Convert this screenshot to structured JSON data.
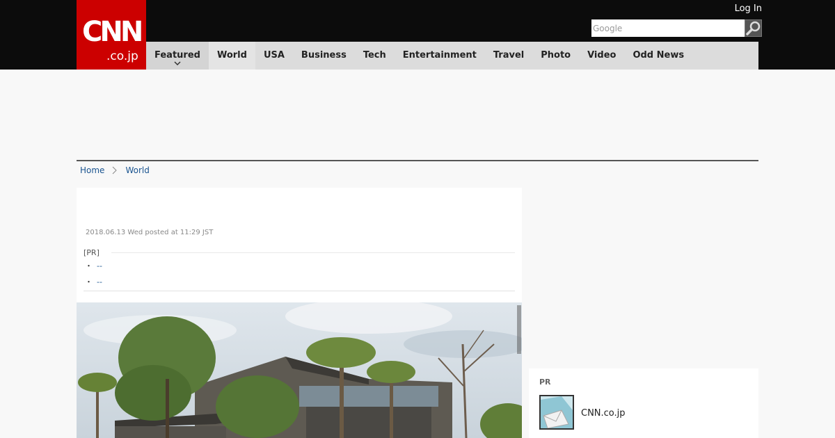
{
  "header": {
    "logo_main": "CNN",
    "logo_sub": ".co.jp",
    "login_label": "Log In",
    "search_placeholder": "Google"
  },
  "nav": {
    "items": [
      {
        "label": "Featured"
      },
      {
        "label": "World"
      },
      {
        "label": "USA"
      },
      {
        "label": "Business"
      },
      {
        "label": "Tech"
      },
      {
        "label": "Entertainment"
      },
      {
        "label": "Travel"
      },
      {
        "label": "Photo"
      },
      {
        "label": "Video"
      },
      {
        "label": "Odd News"
      }
    ]
  },
  "breadcrumb": {
    "home": "Home",
    "section": "World"
  },
  "article": {
    "date": "2018.06.13 Wed posted at 11:29 JST",
    "pr_label": "[PR]",
    "pr_items": [
      {
        "bullet": "・",
        "link": "--"
      },
      {
        "bullet": "・",
        "link": "--"
      }
    ]
  },
  "sidebar": {
    "pr_label": "PR",
    "pr_name": "CNN.co.jp"
  },
  "colors": {
    "brand_red": "#cc0000",
    "header_black": "#0c0c0c",
    "nav_gray": "#dcdcdc",
    "link_blue": "#1a5490"
  },
  "icons": {
    "search": "magnifier-icon",
    "caret": "chevron-down-icon",
    "breadcrumb_sep": "chevron-right-icon"
  }
}
